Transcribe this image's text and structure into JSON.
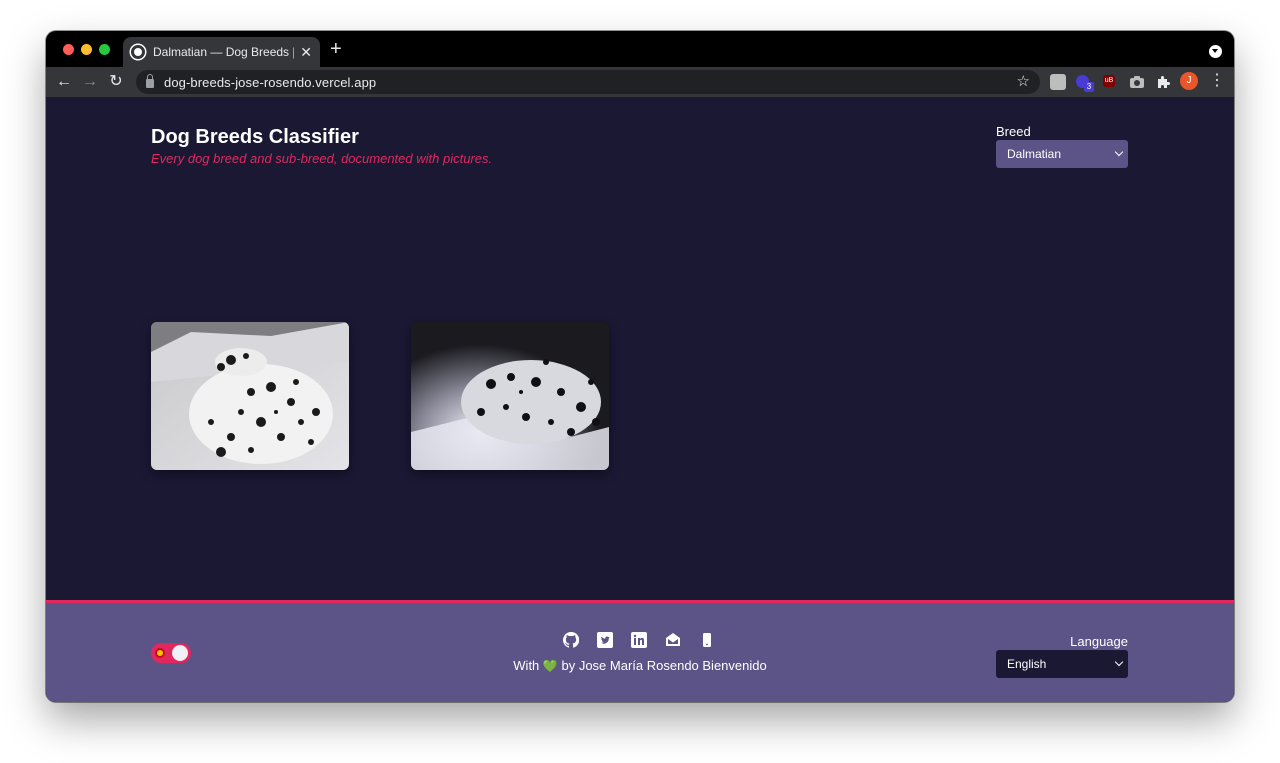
{
  "browser": {
    "tab_title": "Dalmatian — Dog Breeds | Jose",
    "tab_close": "✕",
    "new_tab": "+",
    "url": "dog-breeds-jose-rosendo.vercel.app",
    "extension_badge": "3",
    "extension_ub": "uB",
    "profile_initial": "J",
    "nav_back": "←",
    "nav_forward": "→",
    "nav_reload": "↻",
    "star": "☆",
    "menu": "⋮"
  },
  "header": {
    "title": "Dog Breeds Classifier",
    "subtitle": "Every dog breed and sub-breed, documented with pictures."
  },
  "breed_picker": {
    "label": "Breed",
    "selected": "Dalmatian"
  },
  "gallery": {
    "photos": [
      {
        "subject": "dalmatian-sleeping-on-white-sheets"
      },
      {
        "subject": "dalmatian-in-dim-light"
      }
    ]
  },
  "footer": {
    "credit_prefix": "With",
    "credit_suffix": "by Jose María Rosendo Bienvenido",
    "heart": "💚",
    "language_label": "Language",
    "language_selected": "English",
    "social_icons": [
      "github-icon",
      "twitter-icon",
      "linkedin-icon",
      "email-icon",
      "phone-icon"
    ]
  },
  "colors": {
    "page_bg": "#1a1833",
    "footer_bg": "#5c5387",
    "accent": "#e0285f"
  }
}
